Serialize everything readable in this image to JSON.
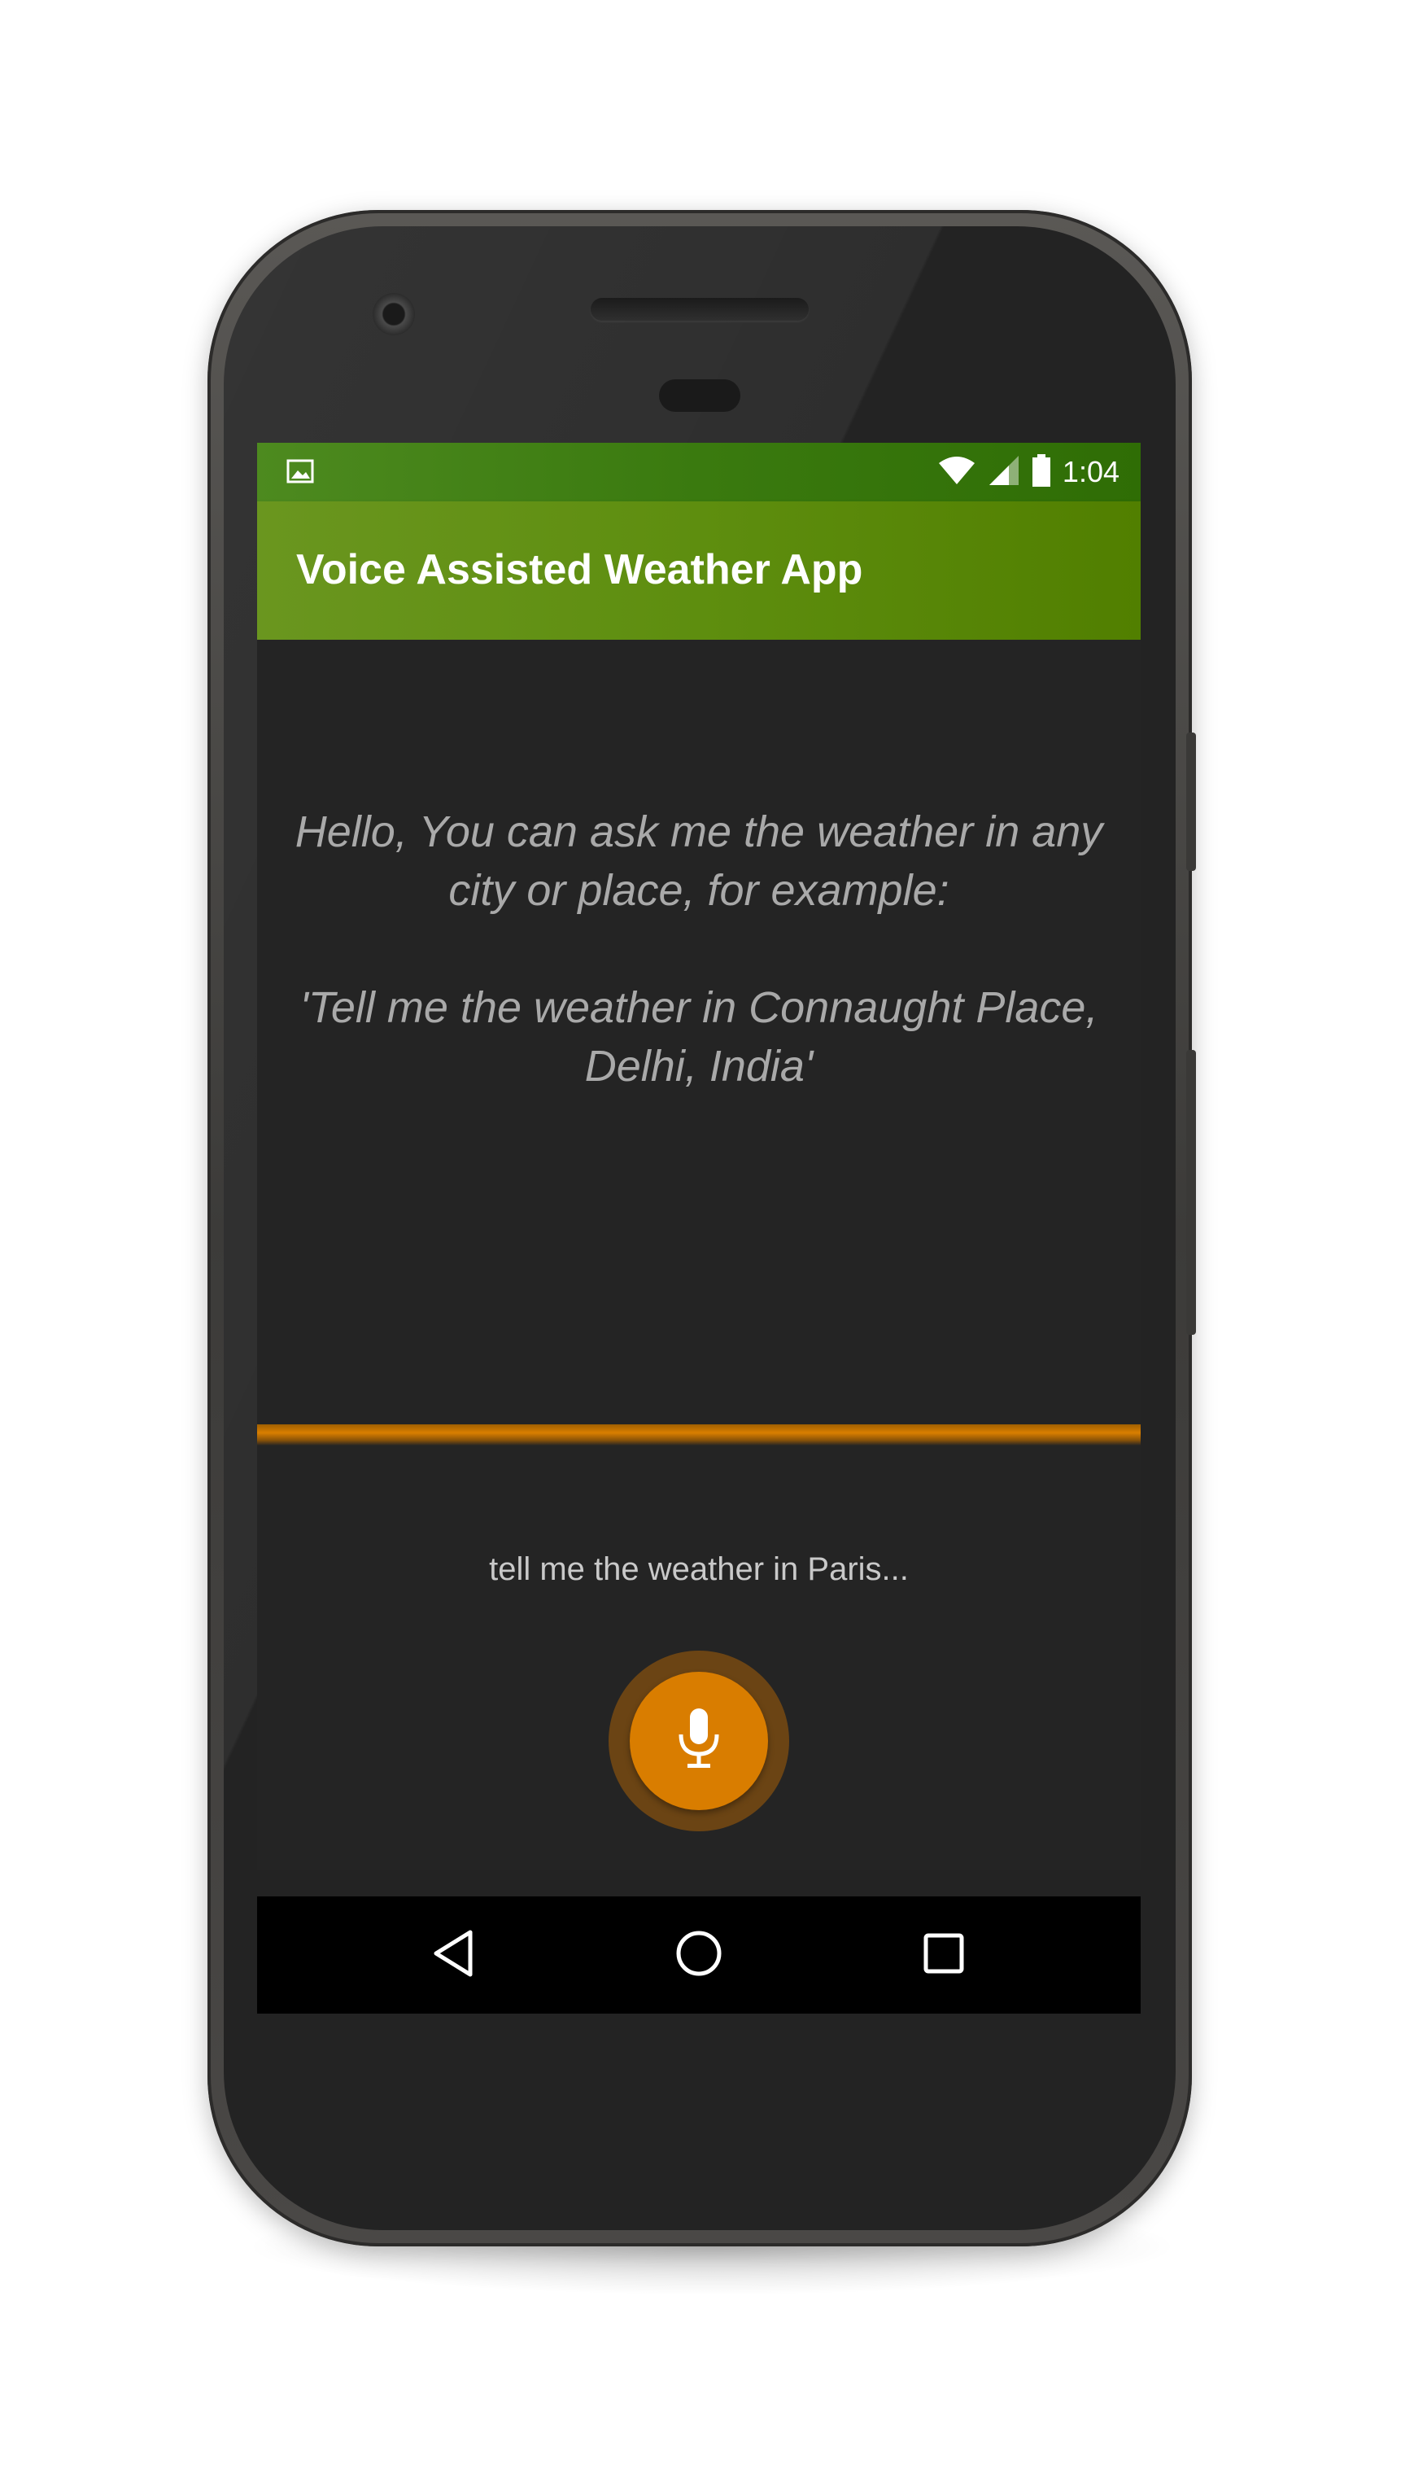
{
  "status_bar": {
    "time": "1:04",
    "icons": [
      "image-notification-icon",
      "wifi-icon",
      "cell-signal-icon",
      "battery-icon"
    ]
  },
  "app_bar": {
    "title": "Voice Assisted Weather App"
  },
  "main": {
    "greeting_line1": "Hello, You can ask me the weather in any city or place, for example:",
    "greeting_example": "'Tell me the weather in Connaught Place, Delhi, India'",
    "hint": "tell me the weather in Paris..."
  },
  "mic_button": {
    "icon": "microphone-icon"
  },
  "nav_bar": {
    "icons": [
      "back-icon",
      "home-icon",
      "recents-icon"
    ]
  },
  "colors": {
    "status_bar": "#3a7a0f",
    "app_bar": "#5e8e0f",
    "accent": "#d97d00",
    "background": "#242424",
    "greeting_text": "#a9a9a9"
  }
}
